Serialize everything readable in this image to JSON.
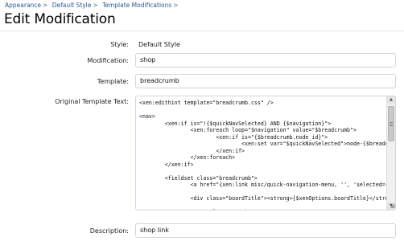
{
  "breadcrumb": {
    "items": [
      "Appearance",
      "Default Style",
      "Template Modifications"
    ],
    "separator": ">"
  },
  "page": {
    "title": "Edit Modification"
  },
  "form": {
    "style": {
      "label": "Style:",
      "value": "Default Style"
    },
    "modification": {
      "label": "Modification:",
      "value": "shop"
    },
    "template": {
      "label": "Template:",
      "value": "breadcrumb"
    },
    "original_template": {
      "label": "Original Template Text:",
      "lines": [
        "<xen:edithint template=\"breadcrumb.css\" />",
        "",
        "<nav>",
        "        <xen:if is=\"!{$quickNavSelected} AND {$navigation}\">",
        "                <xen:foreach loop=\"$navigation\" value=\"$breadcrumb\">",
        "                        <xen:if is=\"{$breadcrumb.node_id}\">",
        "                                <xen:set var=\"$quickNavSelected\">node-{$breadcrumb.node_id}</xen:set>",
        "                        </xen:if>",
        "                </xen:foreach>",
        "        </xen:if>",
        "",
        "        <fieldset class=\"breadcrumb\">",
        "                <a href=\"{xen:link misc/quick-navigation-menu, '', 'selected={$quickNavSelected}'}\"",
        "",
        "                <div class=\"boardTitle\"><strong>{$xenOptions.boardTitle}</strong></div>",
        "",
        "                <span class=\"crumbs\">"
      ]
    },
    "description": {
      "label": "Description:",
      "value": "shop link"
    }
  },
  "colors": {
    "link": "#2b5a8c",
    "border": "#cfd6de",
    "divider": "#e6e6e6"
  },
  "icons": {
    "scroll_up": "triangle-up-icon",
    "scroll_down": "triangle-down-icon",
    "resize": "resize-grip-icon"
  }
}
